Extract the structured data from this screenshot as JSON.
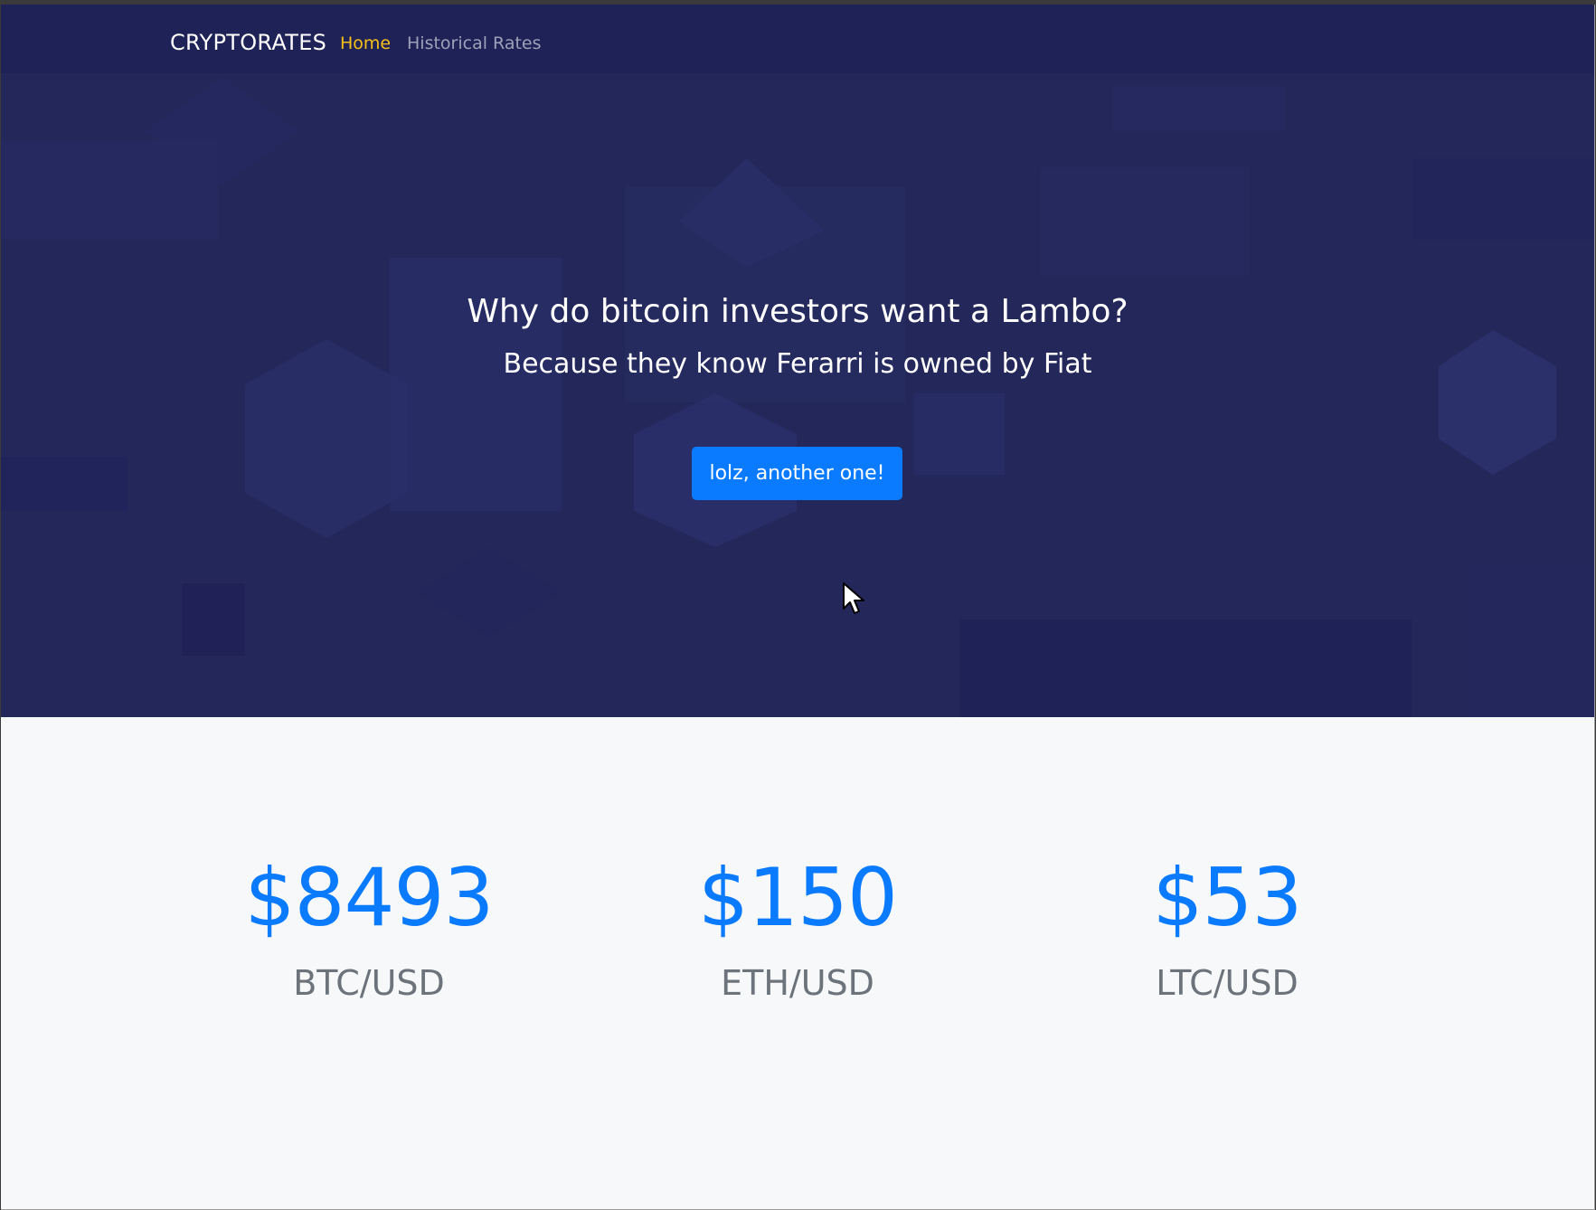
{
  "navbar": {
    "brand": "CRYPTORATES",
    "links": [
      {
        "label": "Home",
        "active": true
      },
      {
        "label": "Historical Rates",
        "active": false
      }
    ]
  },
  "hero": {
    "title": "Why do bitcoin investors want a Lambo?",
    "subtitle": "Because they know Ferarri is owned by Fiat",
    "button_label": "lolz, another one!"
  },
  "rates": [
    {
      "value": "$8493",
      "pair": "BTC/USD"
    },
    {
      "value": "$150",
      "pair": "ETH/USD"
    },
    {
      "value": "$53",
      "pair": "LTC/USD"
    }
  ],
  "colors": {
    "hero_background": "#23275a",
    "navbar_background": "#1f2257",
    "accent": "#0a7bff",
    "active_link": "#f6c018",
    "inactive_link": "#9da1b8",
    "rates_background": "#f7f8fa",
    "pair_text": "#6c737a"
  },
  "icons": {
    "cursor": "mouse-pointer-icon"
  }
}
